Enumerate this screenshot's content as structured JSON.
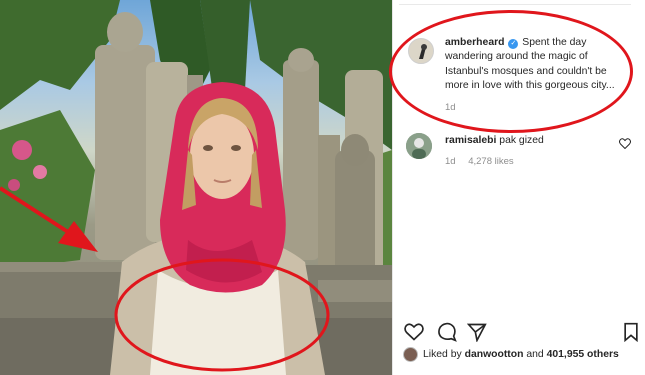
{
  "post": {
    "caption_username": "amberheard",
    "verified_mark": "✓",
    "caption_text": "Spent the day wandering around the magic of Istanbul's mosques and couldn't be more in love with this gorgeous city...",
    "caption_time": "1d"
  },
  "comment": {
    "username": "ramisalebi",
    "text": "pak gized",
    "time": "1d",
    "likes": "4,278 likes"
  },
  "likes_line": {
    "prefix": "Liked by",
    "user": "danwootton",
    "and": "and",
    "count": "401,955 others"
  },
  "icons": [
    "heart-icon",
    "comment-icon",
    "share-icon",
    "bookmark-icon",
    "verified-icon",
    "red-arrow-annotation"
  ],
  "colors": {
    "annotation_red": "#e0161c",
    "verified_blue": "#3897f0",
    "text_dark": "#262626",
    "text_muted": "#8e8e8e",
    "scarf_pink": "#d82a5a"
  }
}
